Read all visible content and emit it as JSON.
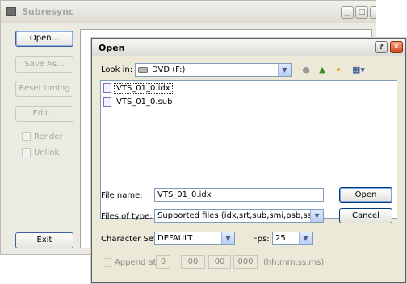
{
  "back_window": {
    "title": "Subresync",
    "buttons": {
      "open": "Open...",
      "save_as": "Save As...",
      "reset_timing": "Reset timing",
      "edit": "Edit...",
      "exit": "Exit"
    },
    "checkboxes": {
      "render": "Render",
      "unlink": "Unlink"
    }
  },
  "dialog": {
    "title": "Open",
    "help_glyph": "?",
    "close_glyph": "✕",
    "look_in_label": "Look in:",
    "look_in_value": "DVD (F:)",
    "files": [
      {
        "name": "VTS_01_0.idx",
        "selected": true
      },
      {
        "name": "VTS_01_0.sub",
        "selected": false
      }
    ],
    "file_name_label": "File name:",
    "file_name_value": "VTS_01_0.idx",
    "files_of_type_label": "Files of type:",
    "files_of_type_value": "Supported files (idx,srt,sub,smi,psb,ssa,ass,v",
    "character_set_label": "Character Set:",
    "character_set_value": "DEFAULT",
    "fps_label": "Fps:",
    "fps_value": "25",
    "append_at_label": "Append at:",
    "append_fields": [
      "0",
      "00",
      "00",
      "000"
    ],
    "time_format_hint": "(hh:mm:ss.ms)",
    "open_button": "Open",
    "cancel_button": "Cancel"
  },
  "icons": {
    "dropdown": "▼",
    "back": "back-icon",
    "up_folder": "up-folder-icon",
    "new_folder": "new-folder-icon",
    "views": "views-menu-icon"
  }
}
